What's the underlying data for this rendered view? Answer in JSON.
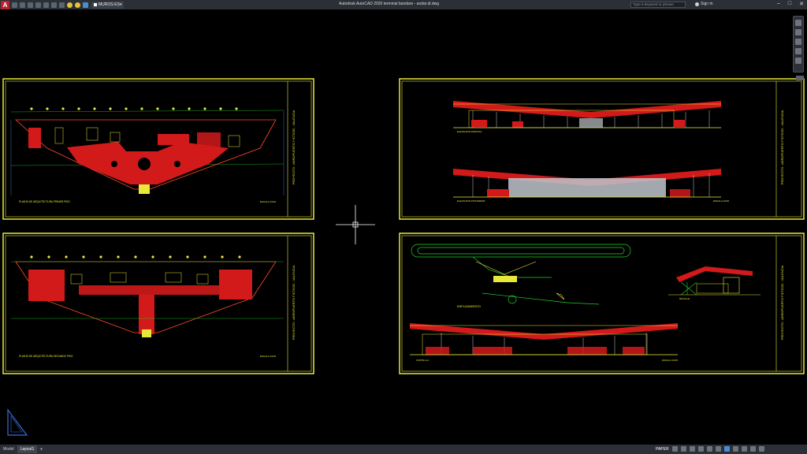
{
  "titlebar": {
    "app_logo": "A",
    "layer_name": "MUROS-ES",
    "window_title": "Autodesk AutoCAD 2020   terminal bandare - aodar.id.dwg",
    "search_placeholder": "Type a keyword or phrase",
    "signin_label": "Sign In",
    "icons": [
      "new-icon",
      "open-icon",
      "save-icon",
      "saveas-icon",
      "print-icon",
      "undo-icon",
      "redo-icon",
      "lightbulb-icon",
      "sun-icon",
      "layer-icon"
    ]
  },
  "sheets": [
    {
      "id": "plan-upper",
      "caption": "PLANTA DE ARQUITECTURA PRIMER PISO",
      "scale": "ESCALA 1/100",
      "title_block": "PROYECTO : AEROPUERTO FICTICIO - VALENCIA"
    },
    {
      "id": "elevations",
      "caption_top": "ELEVACION FRONTAL",
      "caption_bottom": "ELEVACION POSTERIOR",
      "scale": "ESCALA 1/100",
      "title_block": "PROYECTO : AEROPUERTO FICTICIO - VALENCIA"
    },
    {
      "id": "plan-lower",
      "caption": "PLANTA DE ARQUITECTURA SEGUNDO PISO",
      "scale": "ESCALA 1/100",
      "title_block": "PROYECTO : AEROPUERTO FICTICIO - VALENCIA"
    },
    {
      "id": "site-section",
      "site_label": "EMPLAZAMIENTO",
      "detail_caption": "DETALLE",
      "section_caption": "CORTE A-A",
      "scale": "ESCALA 1/100",
      "title_block": "PROYECTO : AEROPUERTO FICTICIO - VALENCIA"
    }
  ],
  "statusbar": {
    "tabs": [
      "Model",
      "Layout1"
    ],
    "active_tab": "Layout1",
    "add_tab": "+",
    "mode_label": "PAPER"
  },
  "colors": {
    "frame": "#e8e83a",
    "wall": "#ff2020",
    "roof": "#e3201b",
    "glazing": "#bfc4cc",
    "column": "#ffffff",
    "grid": "#22d12a",
    "dim": "#2a8cff"
  }
}
